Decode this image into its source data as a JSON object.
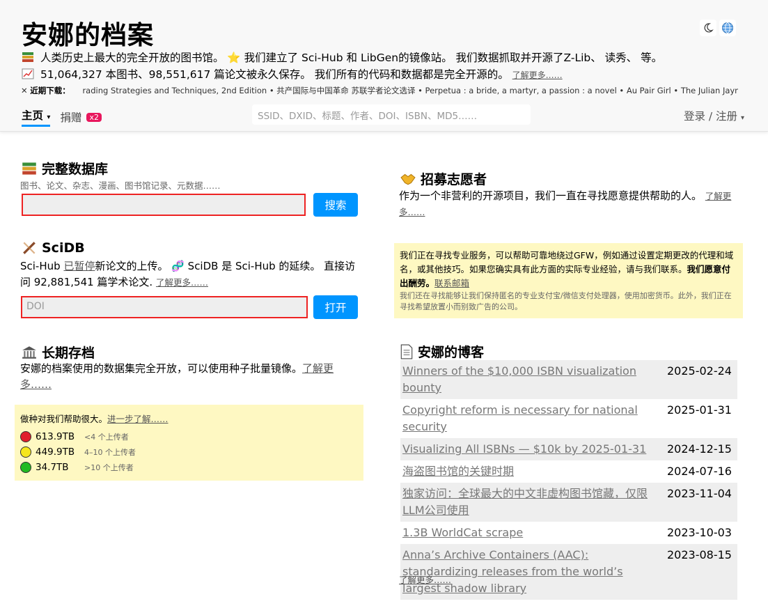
{
  "header": {
    "site_title": "安娜的档案",
    "tagline1": "人类历史上最大的完全开放的图书馆。 ⭐ 我们建立了 Sci-Hub 和 LibGen的镜像站。 我们数据抓取并开源了Z-Lib、 读秀、 等。",
    "tagline2": "51,064,327 本图书、98,551,617 篇论文被永久保存。 我们所有的代码和数据都是完全开源的。",
    "tagline2_link": "了解更多……",
    "recent_label": "近期下载：",
    "recent_items": "rading Strategies and Techniques, 2nd Edition • 共产国际与中国革命 苏联学者论文选译 • Perpetua : a bride, a martyr, a passion : a novel • Au Pair Girl • The Julian Jaynes",
    "icons": [
      "moon-icon",
      "globe-icon"
    ]
  },
  "nav": {
    "home": "主页",
    "donate": "捐赠",
    "donate_badge": "x2",
    "search_placeholder": "SSID、DXID、标题、作者、DOI、ISBN、MD5……",
    "login": "登录 / 注册"
  },
  "full_db": {
    "title": "完整数据库",
    "subtitle": "图书、论文、杂志、漫画、图书馆记录、元数据……",
    "input_value": "",
    "button": "搜索"
  },
  "scidb": {
    "title": "SciDB",
    "text_a": "Sci-Hub ",
    "paused_link": "已暂停",
    "text_b": "新论文的上传。 🧬 SciDB 是 Sci-Hub 的延续。 直接访问 92,881,541 篇学术论文.",
    "more_link": "了解更多……",
    "input_placeholder": "DOI",
    "button": "打开"
  },
  "long_term": {
    "title": "长期存档",
    "text": "安娜的档案使用的数据集完全开放，可以使用种子批量镜像。",
    "more_link": "了解更多……"
  },
  "seeding": {
    "intro": "做种对我们帮助很大。",
    "intro_link": "进一步了解……",
    "rows": [
      {
        "size": "613.9TB",
        "desc": "<4 个上传者",
        "color": "#e01e2b"
      },
      {
        "size": "449.9TB",
        "desc": "4–10 个上传者",
        "color": "#f5e61c"
      },
      {
        "size": "34.7TB",
        "desc": ">10 个上传者",
        "color": "#22bb22"
      }
    ]
  },
  "volunteers": {
    "title": "招募志愿者",
    "text": "作为一个非营利的开源项目，我们一直在寻找愿意提供帮助的人。",
    "more_link": "了解更多……"
  },
  "gfw": {
    "text": "我们正在寻找专业服务，可以帮助可靠地绕过GFW，例如通过设置定期更改的代理和域名，或其他技巧。如果您确实具有此方面的实际专业经验，请与我们联系。",
    "bold": "我们愿意付出酬劳。",
    "link": "联系邮箱",
    "small": "我们还在寻找能够让我们保持匿名的专业支付宝/微信支付处理器，使用加密货币。此外，我们正在寻找希望放置小而别致广告的公司。"
  },
  "blog": {
    "title": "安娜的博客",
    "posts": [
      {
        "title": "Winners of the $10,000 ISBN visualization bounty",
        "date": "2025-02-24"
      },
      {
        "title": "Copyright reform is necessary for national security",
        "date": "2025-01-31"
      },
      {
        "title": "Visualizing All ISBNs — $10k by 2025-01-31",
        "date": "2024-12-15"
      },
      {
        "title": "海盗图书馆的关键时期",
        "date": "2024-07-16"
      },
      {
        "title": "独家访问：全球最大的中文非虚构图书馆藏，仅限LLM公司使用",
        "date": "2023-11-04"
      },
      {
        "title": "1.3B WorldCat scrape",
        "date": "2023-10-03"
      },
      {
        "title": "Anna’s Archive Containers (AAC): standardizing releases from the world’s largest shadow library",
        "date": "2023-08-15"
      }
    ],
    "more_link": "了解更多……"
  }
}
